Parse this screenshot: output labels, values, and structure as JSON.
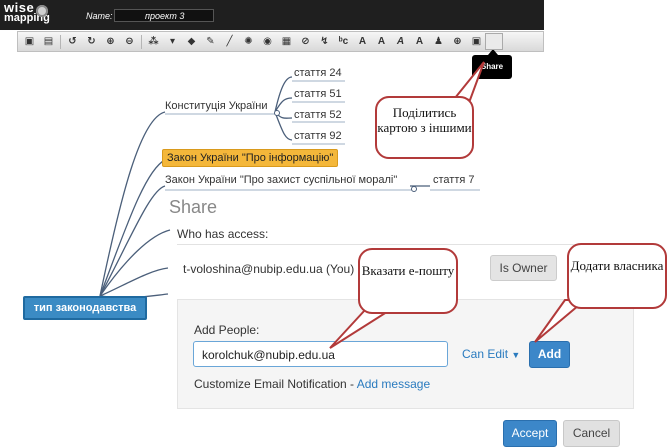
{
  "header": {
    "logo_line1": "wise",
    "logo_line2": "mapping",
    "name_label": "Name:",
    "name_value": "проект 3"
  },
  "toolbar": {
    "icons": [
      "save-icon",
      "print-icon",
      "undo-icon",
      "redo-icon",
      "zoom-in-icon",
      "zoom-out-icon",
      "add-topic-icon",
      "expand-icon",
      "collapse-icon",
      "pen-icon",
      "connection-icon",
      "palette-icon",
      "shape-icon",
      "note-icon",
      "link-icon",
      "relationship-icon",
      "font-icon",
      "font-size-up-icon",
      "bold-icon",
      "italic-icon",
      "font-color-icon",
      "share-icon",
      "globe-icon",
      "export-icon"
    ],
    "tooltip": "Share"
  },
  "mindmap": {
    "root": "тип законодавства",
    "nodes": {
      "constitution": "Конституція України",
      "info_law": "Закон України \"Про інформацію\"",
      "morality_law": "Закон України \"Про захист суспільної моралі\"",
      "art24": "стаття 24",
      "art51": "стаття 51",
      "art52": "стаття 52",
      "art92": "стаття 92",
      "art7": "стаття 7"
    }
  },
  "callouts": {
    "share_map": "Поділитись картою з іншими",
    "email": "Вказати е-пошту",
    "add_owner": "Додати власника"
  },
  "dialog": {
    "title": "Share",
    "who_has_access": "Who has access:",
    "owner_email": "t-voloshina@nubip.edu.ua (You)",
    "owner_role": "Is Owner",
    "add_people_label": "Add People:",
    "email_value": "korolchuk@nubip.edu.ua",
    "permission": "Can Edit",
    "add_button": "Add",
    "customize_text": "Customize Email Notification - ",
    "add_message_link": "Add message",
    "accept_button": "Accept",
    "cancel_button": "Cancel"
  },
  "colors": {
    "accent": "#3c87c9",
    "highlight_node": "#f4b73a",
    "root_node": "#3b8bc4",
    "callout_border": "#b23a3a",
    "map_lines": "#4b5f7a"
  }
}
